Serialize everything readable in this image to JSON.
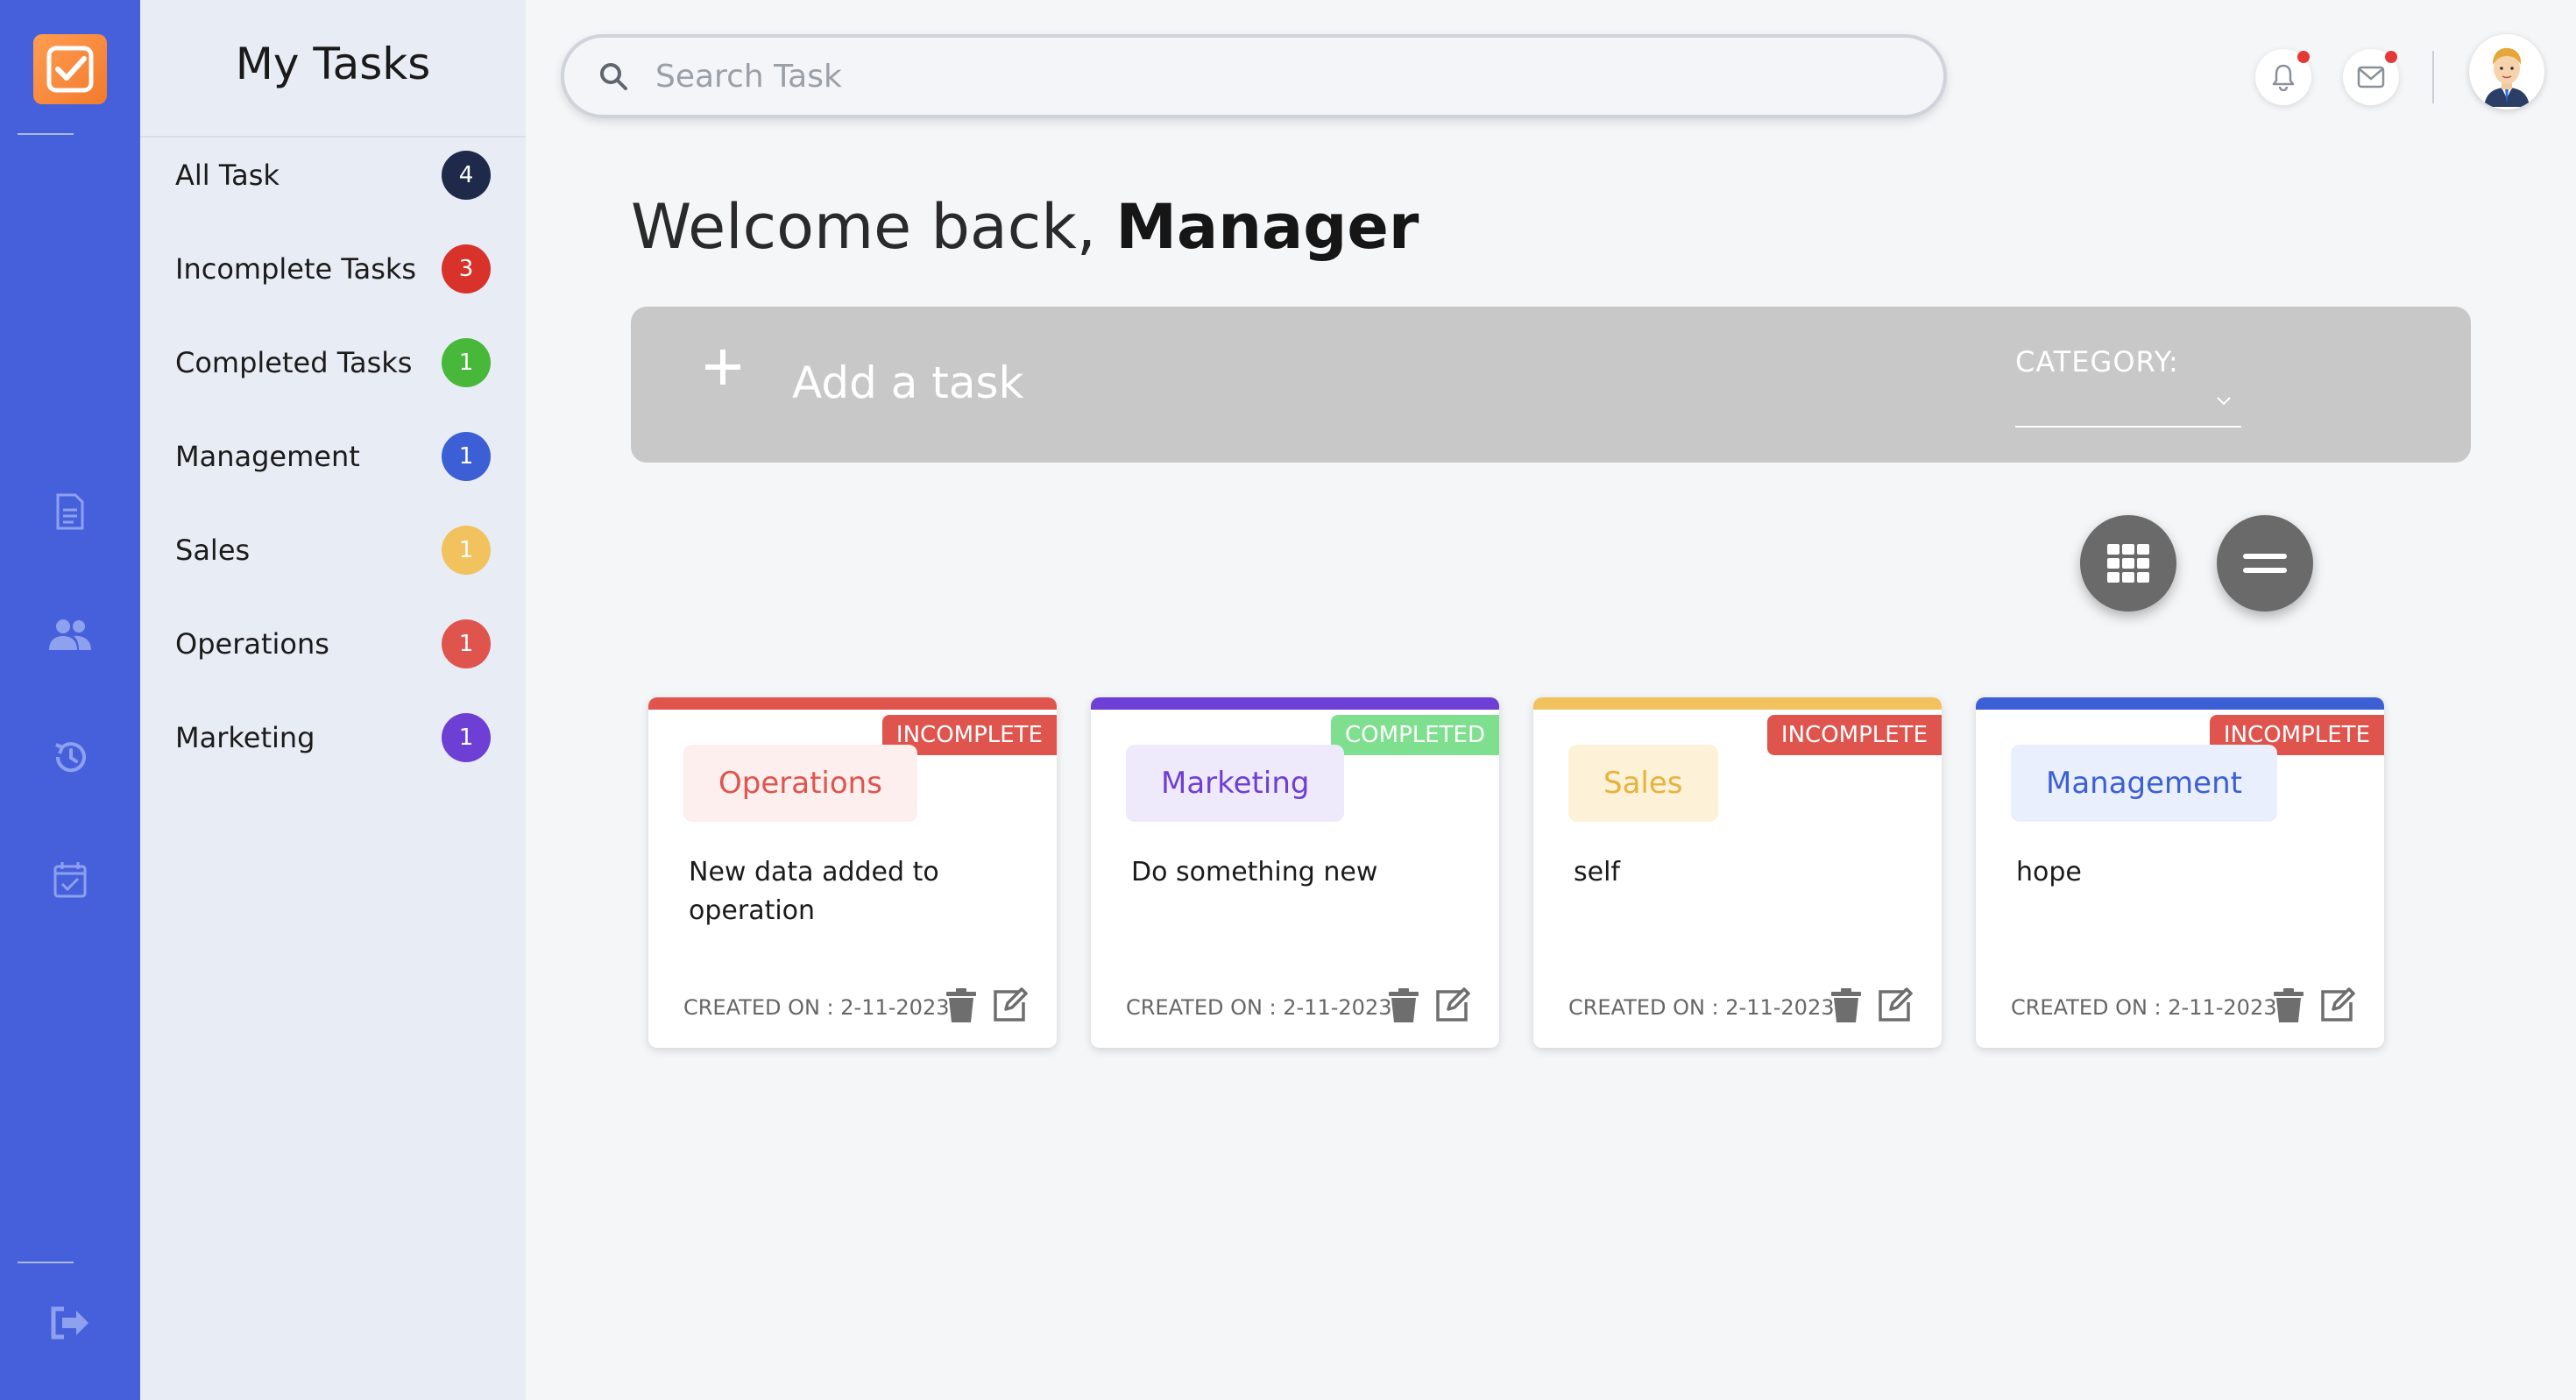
{
  "sidebar": {
    "title": "My Tasks",
    "items": [
      {
        "label": "All Task",
        "count": "4",
        "color": "#1f2a4a"
      },
      {
        "label": "Incomplete Tasks",
        "count": "3",
        "color": "#d9322a"
      },
      {
        "label": "Completed Tasks",
        "count": "1",
        "color": "#47b83a"
      },
      {
        "label": "Management",
        "count": "1",
        "color": "#3d5fd6"
      },
      {
        "label": "Sales",
        "count": "1",
        "color": "#f1c25e"
      },
      {
        "label": "Operations",
        "count": "1",
        "color": "#e0544e"
      },
      {
        "label": "Marketing",
        "count": "1",
        "color": "#6e3fd4"
      }
    ]
  },
  "search": {
    "placeholder": "Search Task"
  },
  "welcome": {
    "greeting": "Welcome back,",
    "name": "Manager"
  },
  "add_task": {
    "label": "Add a task",
    "category_label": "CATEGORY:",
    "category_value": ""
  },
  "tasks": [
    {
      "category": "Operations",
      "status": "INCOMPLETE",
      "description": "New data added to operation",
      "created": "CREATED ON : 2-11-2023",
      "accent": "#e0544e",
      "chip_bg": "#fcefee",
      "chip_fg": "#e0544e",
      "status_bg": "#e0544e"
    },
    {
      "category": "Marketing",
      "status": "COMPLETED",
      "description": "Do something new",
      "created": "CREATED ON : 2-11-2023",
      "accent": "#6e3fd4",
      "chip_bg": "#efeafb",
      "chip_fg": "#6e3fd4",
      "status_bg": "#7ee08f"
    },
    {
      "category": "Sales",
      "status": "INCOMPLETE",
      "description": "self",
      "created": "CREATED ON : 2-11-2023",
      "accent": "#f1c25e",
      "chip_bg": "#fdf1d8",
      "chip_fg": "#e8b23c",
      "status_bg": "#e0544e"
    },
    {
      "category": "Management",
      "status": "INCOMPLETE",
      "description": "hope",
      "created": "CREATED ON : 2-11-2023",
      "accent": "#3d5fd6",
      "chip_bg": "#e9effc",
      "chip_fg": "#3d5fd6",
      "status_bg": "#e0544e"
    }
  ],
  "icons": {
    "logo": "check-square-icon",
    "rail": [
      "document-icon",
      "users-icon",
      "history-icon",
      "calendar-check-icon",
      "logout-icon"
    ],
    "top": [
      "bell-icon",
      "mail-icon"
    ]
  },
  "colors": {
    "rail": "#4660dc",
    "sidebar": "#e8ecf5",
    "logo": "#f5873b",
    "badge_dot": "#e53935"
  }
}
